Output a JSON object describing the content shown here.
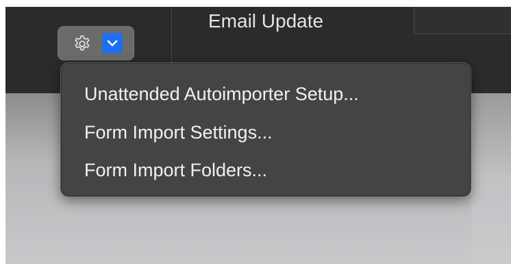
{
  "toolbar": {
    "title": "Email Update"
  },
  "gear_button": {
    "icon": "gear-icon",
    "dropdown_icon": "chevron-down-icon",
    "accent_color": "#1e6ff0"
  },
  "menu": {
    "items": [
      {
        "label": "Unattended Autoimporter Setup..."
      },
      {
        "label": "Form Import Settings..."
      },
      {
        "label": "Form Import Folders..."
      }
    ]
  }
}
